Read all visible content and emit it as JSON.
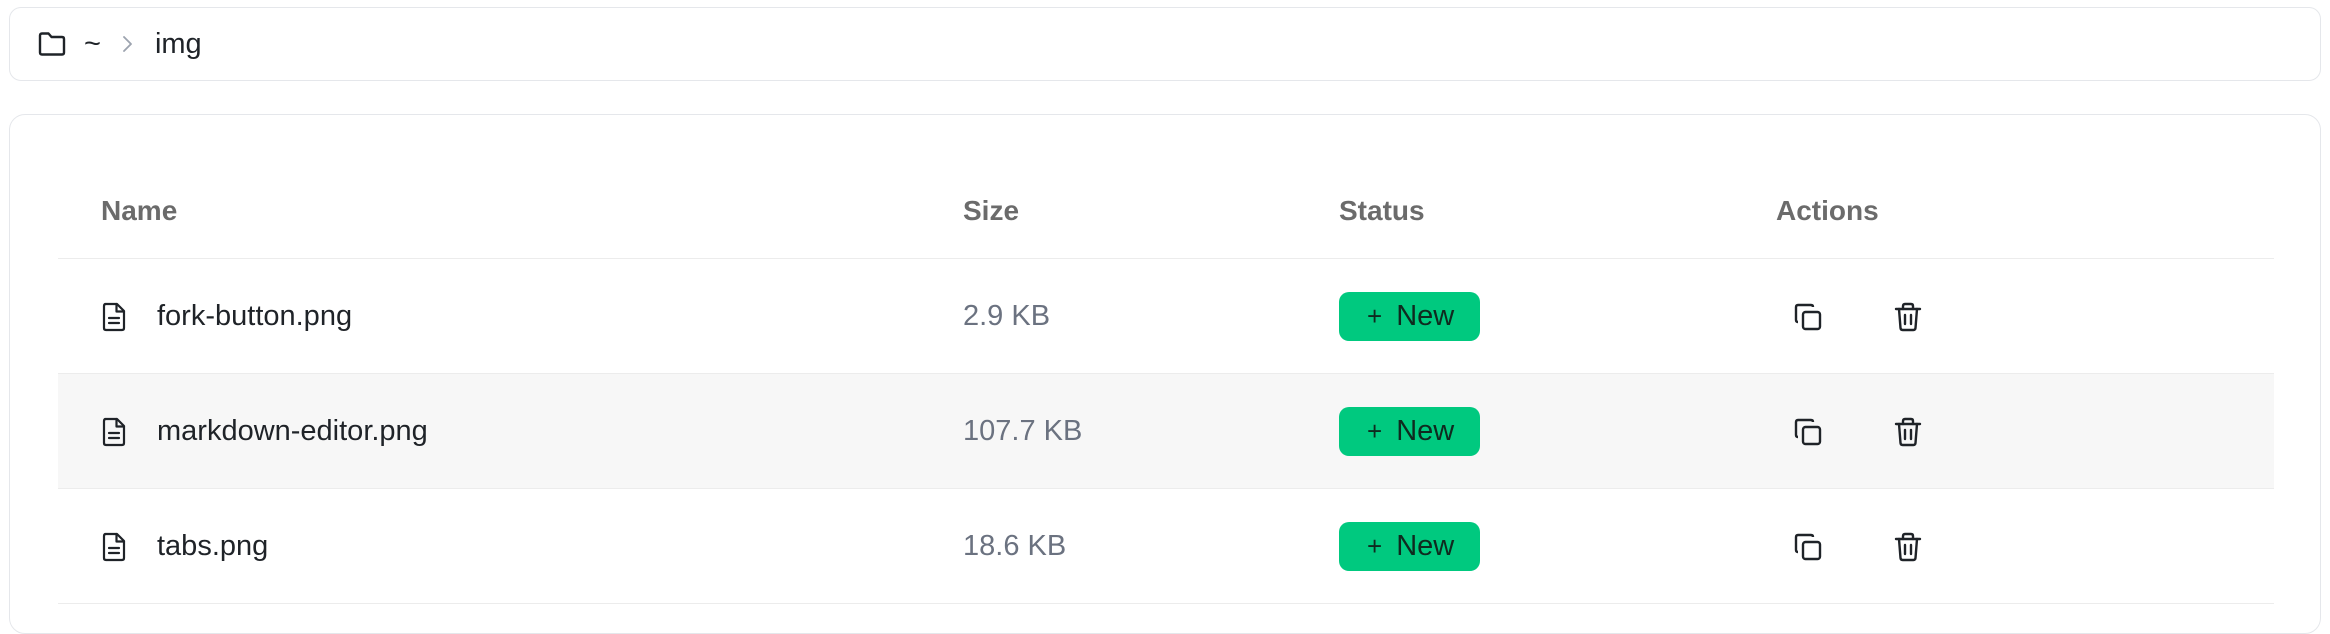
{
  "breadcrumb": {
    "home": "~",
    "current": "img"
  },
  "table": {
    "columns": {
      "name": "Name",
      "size": "Size",
      "status": "Status",
      "actions": "Actions"
    },
    "rows": [
      {
        "name": "fork-button.png",
        "size": "2.9 KB",
        "status": "New"
      },
      {
        "name": "markdown-editor.png",
        "size": "107.7 KB",
        "status": "New"
      },
      {
        "name": "tabs.png",
        "size": "18.6 KB",
        "status": "New"
      }
    ]
  },
  "badge_plus": "+",
  "colors": {
    "status_new": "#00c97f",
    "border": "#e5e7eb",
    "row_alt": "#f7f7f7",
    "header_text": "#6b6b6b",
    "size_text": "#6b7280"
  },
  "icons": {
    "folder": "folder-icon",
    "separator": "chevron-right-icon",
    "file": "file-text-icon",
    "copy": "copy-icon",
    "delete": "trash-icon"
  }
}
